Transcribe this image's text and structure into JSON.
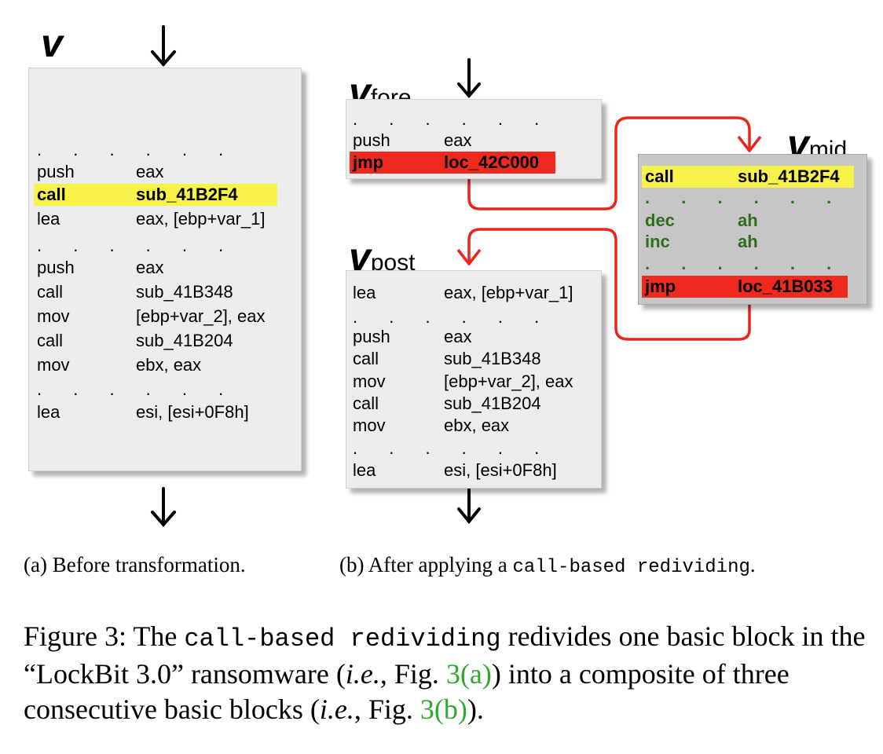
{
  "panel_a": {
    "label": "v",
    "rows": [
      {
        "op": "push",
        "arg": "eax"
      },
      {
        "op": "call",
        "arg": "sub_41B2F4"
      },
      {
        "op": "lea",
        "arg": "eax, [ebp+var_1]"
      },
      {
        "op": "push",
        "arg": "eax"
      },
      {
        "op": "call",
        "arg": "sub_41B348"
      },
      {
        "op": "mov",
        "arg": "[ebp+var_2], eax"
      },
      {
        "op": "call",
        "arg": "sub_41B204"
      },
      {
        "op": "mov",
        "arg": "ebx, eax"
      },
      {
        "op": "lea",
        "arg": "esi, [esi+0F8h]"
      }
    ],
    "dots": ". . . . . ."
  },
  "panel_b": {
    "fore": {
      "label": "v",
      "sub": "fore",
      "rows": [
        {
          "op": "push",
          "arg": "eax"
        },
        {
          "op": "jmp",
          "arg": "loc_42C000"
        }
      ]
    },
    "mid": {
      "label": "v",
      "sub": "mid",
      "rows": [
        {
          "op": "call",
          "arg": "sub_41B2F4"
        },
        {
          "op": "dec",
          "arg": "ah"
        },
        {
          "op": "inc",
          "arg": "ah"
        },
        {
          "op": "jmp",
          "arg": "loc_41B033"
        }
      ]
    },
    "post": {
      "label": "v",
      "sub": "post",
      "rows": [
        {
          "op": "lea",
          "arg": "eax, [ebp+var_1]"
        },
        {
          "op": "push",
          "arg": "eax"
        },
        {
          "op": "call",
          "arg": "sub_41B348"
        },
        {
          "op": "mov",
          "arg": "[ebp+var_2], eax"
        },
        {
          "op": "call",
          "arg": "sub_41B204"
        },
        {
          "op": "mov",
          "arg": "ebx, eax"
        },
        {
          "op": "lea",
          "arg": "esi, [esi+0F8h]"
        }
      ]
    }
  },
  "subcaptions": {
    "a": "(a) Before transformation.",
    "b_prefix": "(b) After applying a ",
    "b_code1": "call",
    "b_code2": "-based redividing",
    "b_suffix": "."
  },
  "figure_caption": {
    "prefix": "Figure 3: The ",
    "code1": "call",
    "code2": "-based redividing",
    "middle": " redivides one basic block in the “LockBit 3.0” ransomware (",
    "ie1": "i.e.",
    "fig_a_text": ", Fig. ",
    "ref_a": "3(a)",
    "middle2": ") into a composite of three consecutive basic blocks (",
    "ie2": "i.e.",
    "fig_b_text": ", Fig. ",
    "ref_b": "3(b)",
    "end": ")."
  },
  "colors": {
    "highlight_call": "#f6f24a",
    "highlight_jmp": "#ee2a1e",
    "arrow_red": "#e8261c",
    "junk_green": "#2f6e1e",
    "ref_green": "#2ea82e"
  }
}
